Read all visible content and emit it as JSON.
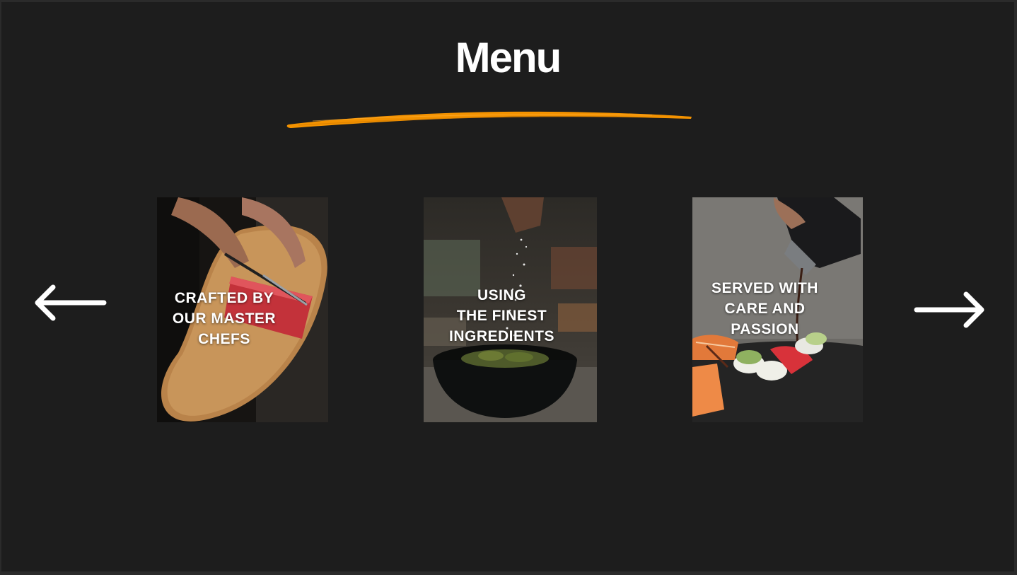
{
  "header": {
    "title": "Menu",
    "accent_color": "#f39200"
  },
  "navigation": {
    "prev_icon": "arrow-left-icon",
    "next_icon": "arrow-right-icon"
  },
  "cards": [
    {
      "caption_lines": [
        "CRAFTED BY",
        "OUR MASTER",
        "CHEFS"
      ],
      "photo": "chef-slicing-tuna-photo"
    },
    {
      "caption_lines": [
        "USING",
        "THE FINEST",
        "INGREDIENTS"
      ],
      "photo": "salt-sprinkled-edamame-photo"
    },
    {
      "caption_lines": [
        "SERVED WITH",
        "CARE AND",
        "PASSION"
      ],
      "photo": "sushi-sauce-drizzle-photo"
    }
  ],
  "colors": {
    "background": "#1d1d1d",
    "text": "#ffffff",
    "accent": "#f39200"
  }
}
